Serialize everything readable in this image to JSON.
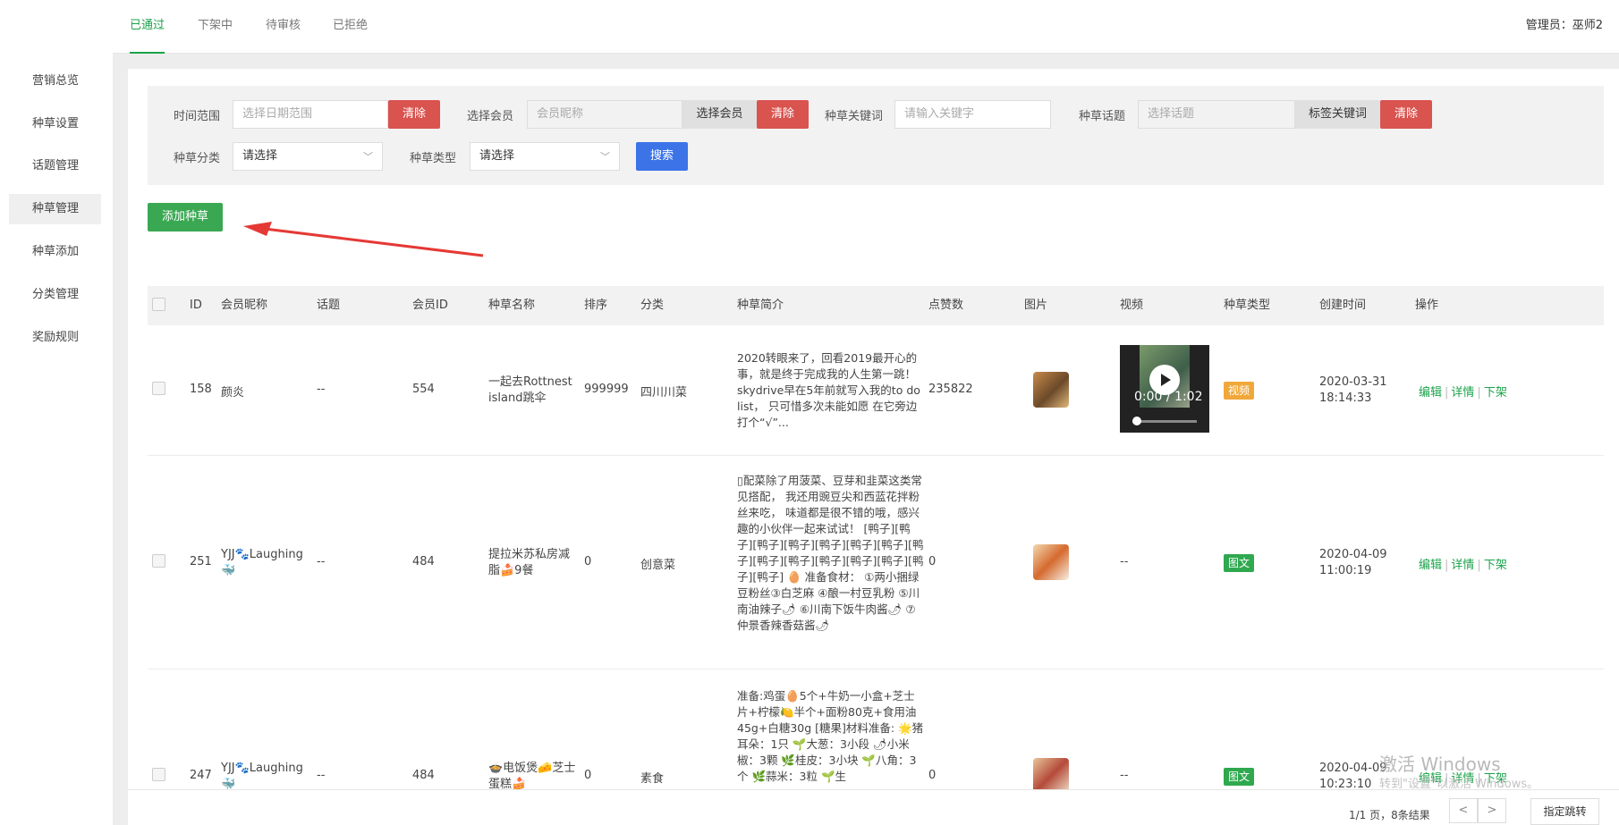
{
  "sidebar": {
    "items": [
      {
        "label": "营销总览"
      },
      {
        "label": "种草设置"
      },
      {
        "label": "话题管理"
      },
      {
        "label": "种草管理"
      },
      {
        "label": "种草添加"
      },
      {
        "label": "分类管理"
      },
      {
        "label": "奖励规则"
      }
    ],
    "active": "种草管理"
  },
  "tabs": [
    "已通过",
    "下架中",
    "待审核",
    "已拒绝"
  ],
  "admin": "管理员：巫师2",
  "filters": {
    "time_label": "时间范围",
    "time_placeholder": "选择日期范围",
    "clear": "清除",
    "member_label": "选择会员",
    "member_placeholder": "会员昵称",
    "member_btn": "选择会员",
    "keyword_label": "种草关键词",
    "keyword_placeholder": "请输入关键字",
    "topic_label": "种草话题",
    "topic_placeholder": "选择话题",
    "topic_btn": "标签关键词",
    "category_label": "种草分类",
    "category_value": "请选择",
    "type_label": "种草类型",
    "type_value": "请选择",
    "search": "搜索"
  },
  "add_button": "添加种草",
  "table": {
    "headers": [
      "ID",
      "会员昵称",
      "话题",
      "会员ID",
      "种草名称",
      "排序",
      "分类",
      "种草简介",
      "点赞数",
      "图片",
      "视频",
      "种草类型",
      "创建时间",
      "操作"
    ],
    "rows": [
      {
        "id": "158",
        "nickname": "颜炎",
        "topic": "--",
        "member_id": "554",
        "name": "一起去Rottnest island跳伞",
        "sort": "999999",
        "category": "四川川菜",
        "desc": "2020转眼来了，回看2019最开心的事，就是终于完成我的人生第一跳！ skydrive早在5年前就写入我的to do list， 只可惜多次未能如愿 在它旁边打个“√”...",
        "likes": "235822",
        "video_time": "0:00 / 1:02",
        "video": "",
        "type": "视频",
        "type_color": "#f0a83a",
        "created_date": "2020-03-31",
        "created_time": "18:14:33"
      },
      {
        "id": "251",
        "nickname": "YJJ🐾Laughing 🐳",
        "topic": "--",
        "member_id": "484",
        "name": "提拉米苏私房减脂🍰9餐",
        "sort": "0",
        "category": "创意菜",
        "desc": "▯配菜除了用菠菜、豆芽和韭菜这类常见搭配， 我还用豌豆尖和西蓝花拌粉丝来吃， 味道都是很不错的哦，感兴趣的小伙伴一起来试试！ [鸭子][鸭子][鸭子][鸭子][鸭子][鸭子][鸭子][鸭子][鸭子][鸭子][鸭子][鸭子][鸭子][鸭子][鸭子] 🥚 准备食材： ①两小捆绿豆粉丝③白芝麻 ④酿一村豆乳粉 ⑤川南油辣子🌶 ⑥川南下饭牛肉酱🌶 ⑦仲景香辣香菇酱🌶",
        "likes": "0",
        "video": "--",
        "type": "图文",
        "type_color": "#2fa84f",
        "created_date": "2020-04-09",
        "created_time": "11:00:19"
      },
      {
        "id": "247",
        "nickname": "YJJ🐾Laughing 🐳",
        "topic": "--",
        "member_id": "484",
        "name": "🍲电饭煲🧀芝士蛋糕🍰",
        "sort": "0",
        "category": "素食",
        "desc": "准备:鸡蛋🥚5个+牛奶一小盒+芝士片+柠檬🍋半个+面粉80克+食用油45g+白糖30g [糖果]材料准备: 🌟猪耳朵：1只 🌱大葱：3小段 🌶小米椒：3颗 🌿桂皮：3小块 🌱八角：3个 🌿蒜米：3粒 🌱生",
        "likes": "0",
        "video": "--",
        "type": "图文",
        "type_color": "#2fa84f",
        "created_date": "2020-04-09",
        "created_time": "10:23:10"
      }
    ],
    "ops": [
      "编辑",
      "详情",
      "下架"
    ]
  },
  "pagination": {
    "info": "1/1 页，8条结果",
    "prev": "<",
    "next": ">",
    "jump": "指定跳转"
  },
  "watermark": {
    "line1": "激活 Windows",
    "line2": "转到\"设置\"以激活 Windows。"
  }
}
